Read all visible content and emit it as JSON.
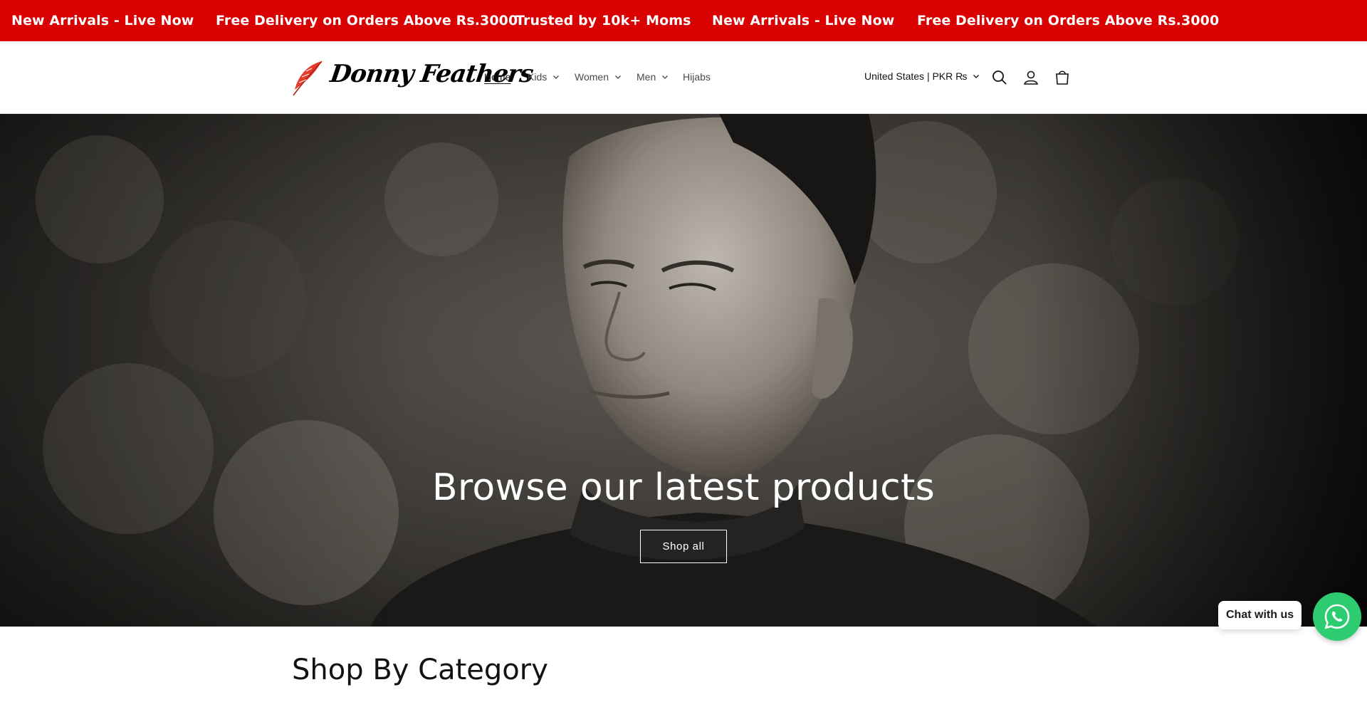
{
  "announcement_bar": {
    "messages": [
      "New Arrivals - Live Now",
      "Free Delivery on Orders Above Rs.3000",
      "Trusted by 10k+ Moms",
      "New Arrivals - Live Now",
      "Free Delivery on Orders Above Rs.3000"
    ],
    "background": "#d80000"
  },
  "header": {
    "logo_text": "Donny Feathers",
    "logo_icon": "feather-icon",
    "nav": [
      {
        "label": "Home",
        "active": true,
        "dropdown": false
      },
      {
        "label": "Kids",
        "active": false,
        "dropdown": true
      },
      {
        "label": "Women",
        "active": false,
        "dropdown": true
      },
      {
        "label": "Men",
        "active": false,
        "dropdown": true
      },
      {
        "label": "Hijabs",
        "active": false,
        "dropdown": false
      }
    ],
    "locale_label": "United States | PKR ₨",
    "icons": [
      "search-icon",
      "account-icon",
      "cart-icon"
    ]
  },
  "hero": {
    "title": "Browse our latest products",
    "button_label": "Shop all"
  },
  "section": {
    "title": "Shop By Category"
  },
  "chat": {
    "label": "Chat with us",
    "icon": "whatsapp-icon",
    "color": "#2ecc71"
  }
}
